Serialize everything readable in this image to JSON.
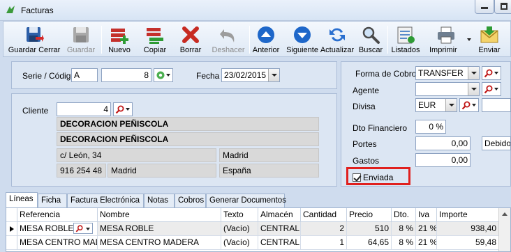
{
  "window": {
    "title": "Facturas"
  },
  "toolbar": {
    "guardar_cerrar": "Guardar Cerrar",
    "guardar": "Guardar",
    "nuevo": "Nuevo",
    "copiar": "Copiar",
    "borrar": "Borrar",
    "deshacer": "Deshacer",
    "anterior": "Anterior",
    "siguiente": "Siguiente",
    "actualizar": "Actualizar",
    "buscar": "Buscar",
    "listados": "Listados",
    "imprimir": "Imprimir",
    "enviar": "Enviar"
  },
  "header": {
    "serie_label": "Serie / Código",
    "serie_value": "A",
    "codigo_value": "8",
    "fecha_label": "Fecha",
    "fecha_value": "23/02/2015"
  },
  "cliente": {
    "label": "Cliente",
    "codigo": "4",
    "nombre1": "DECORACION PEÑISCOLA",
    "nombre2": "DECORACION PEÑISCOLA",
    "direccion": "c/ León, 34",
    "ciudad": "Madrid",
    "telefono": "916 254 48",
    "provincia": "Madrid",
    "pais": "España"
  },
  "right": {
    "forma_cobro_label": "Forma de Cobro",
    "forma_cobro_value": "TRANSFER",
    "agente_label": "Agente",
    "agente_value": "",
    "divisa_label": "Divisa",
    "divisa_value": "EUR",
    "dto_label": "Dto Financiero",
    "dto_value": "0 %",
    "portes_label": "Portes",
    "portes_value": "0,00",
    "portes_extra": "Debido",
    "gastos_label": "Gastos",
    "gastos_value": "0,00",
    "enviada_label": "Enviada"
  },
  "tabs": [
    "Líneas",
    "Ficha",
    "Factura Electrónica",
    "Notas",
    "Cobros",
    "Generar Documentos"
  ],
  "grid": {
    "headers": [
      "Referencia",
      "Nombre",
      "Texto",
      "Almacén",
      "Cantidad",
      "Precio",
      "Dto.",
      "Iva",
      "Importe"
    ],
    "rows": [
      [
        "MESA ROBLE",
        "MESA ROBLE",
        "(Vacío)",
        "CENTRAL",
        "2",
        "510",
        "8 %",
        "21 %",
        "938,40"
      ],
      [
        "MESA CENTRO MADE",
        "MESA CENTRO MADERA",
        "(Vacío)",
        "CENTRAL",
        "1",
        "64,65",
        "8 %",
        "21 %",
        "59,48"
      ]
    ]
  },
  "colors": {
    "highlight": "#e0201e",
    "toolbar_bg": "#dde8f5"
  }
}
